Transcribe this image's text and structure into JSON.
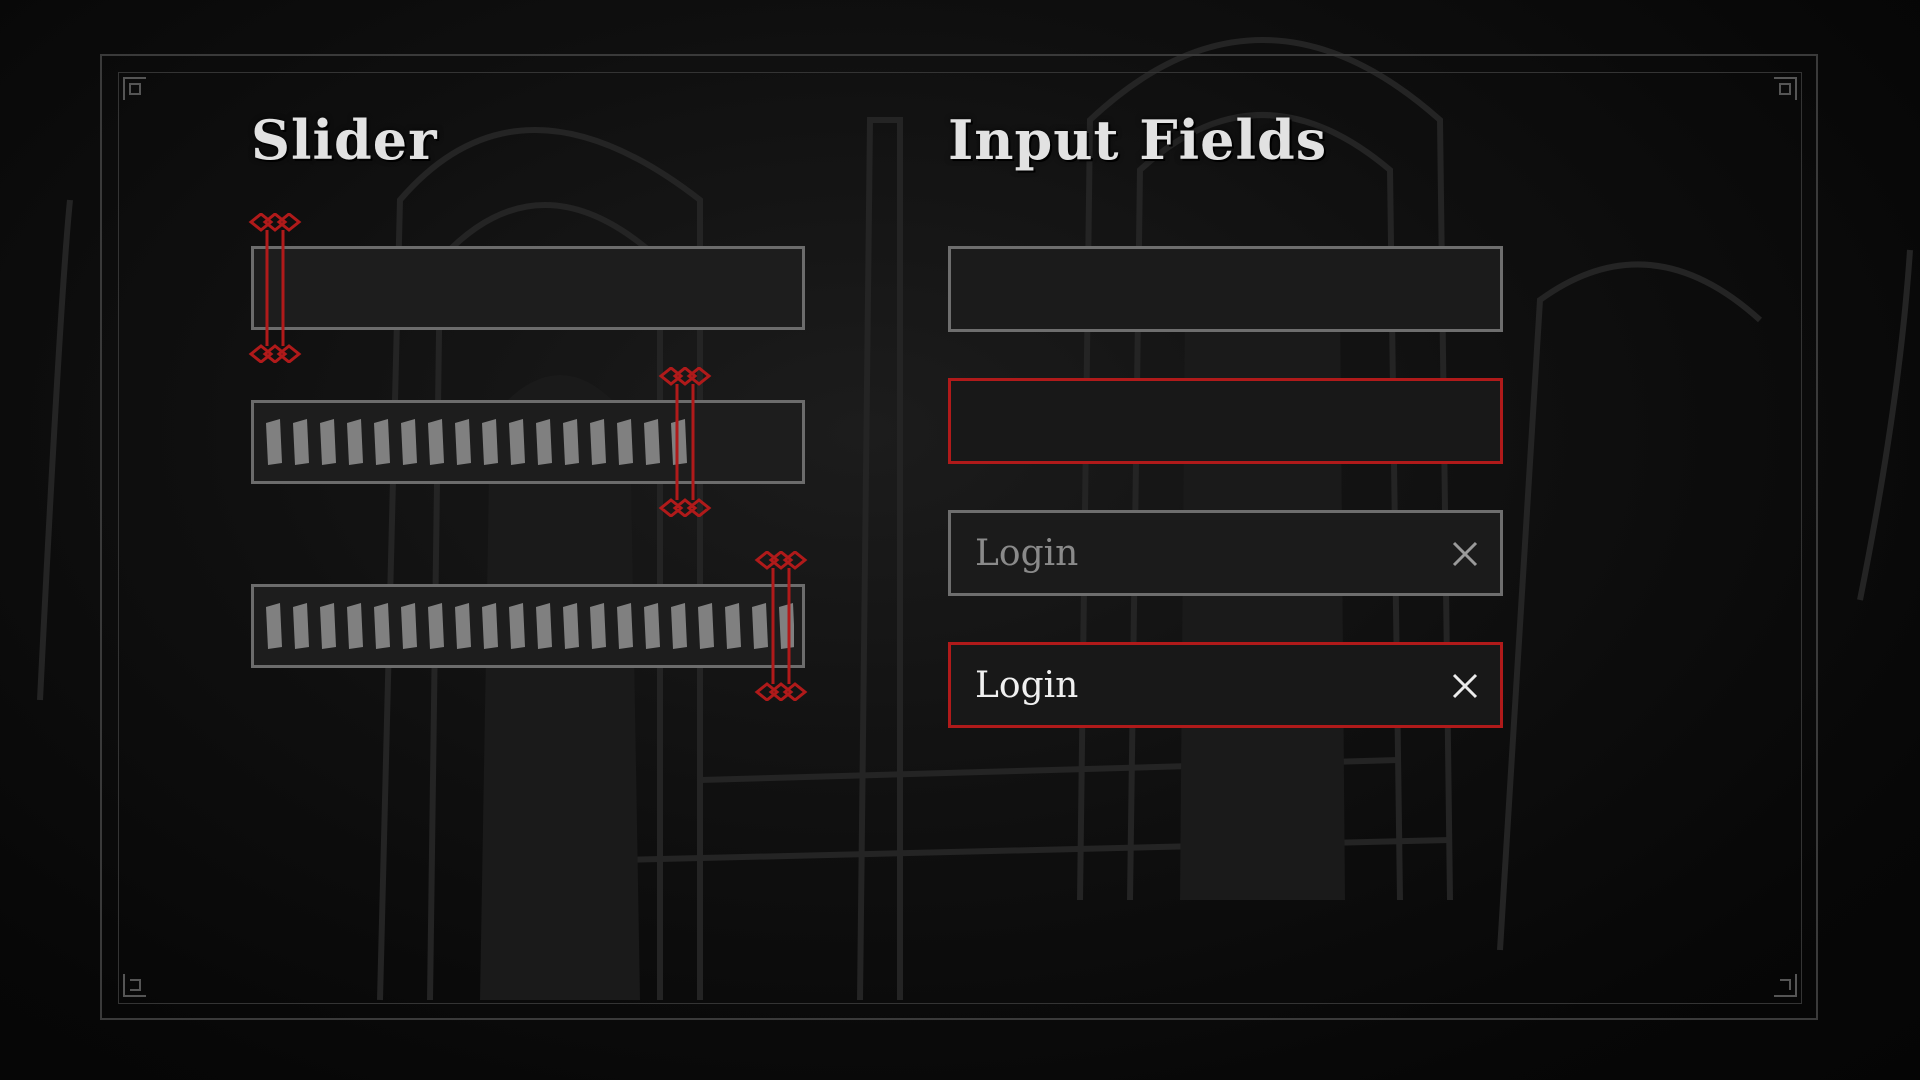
{
  "slider_section": {
    "heading": "Slider",
    "sliders": [
      {
        "value": 0.0
      },
      {
        "value": 0.81
      },
      {
        "value": 1.0
      }
    ]
  },
  "input_section": {
    "heading": "Input Fields",
    "fields": [
      {
        "value": "",
        "state": "default"
      },
      {
        "value": "",
        "state": "focused"
      },
      {
        "value": "Login",
        "state": "placeholder"
      },
      {
        "value": "Login",
        "state": "filled-focused"
      }
    ]
  },
  "icons": {
    "slider_handle": "double-diamond-handle-icon",
    "clear": "close-icon",
    "corner": "corner-ornament-icon"
  },
  "colors": {
    "accent_red": "#b01a1a",
    "border_gray": "#6e6e6e",
    "text_light": "#e8e8e8",
    "text_muted": "#8a8a8a",
    "fill_notch": "#808080"
  }
}
